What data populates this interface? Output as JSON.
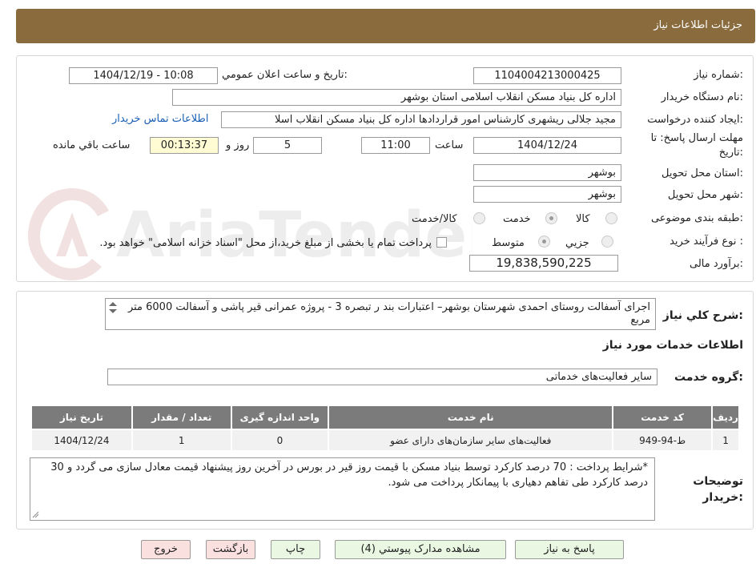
{
  "header": {
    "title": "جزئیات اطلاعات نیاز"
  },
  "fields": {
    "need_number": {
      "label": "شماره نیاز:",
      "value": "1104004213000425"
    },
    "announce_datetime": {
      "label": "تاریخ و ساعت اعلان عمومي:",
      "value": "1404/12/19 - 10:08"
    },
    "buyer_org": {
      "label": "نام دستگاه خريدار:",
      "value": "اداره کل بنیاد مسکن انقلاب اسلامی استان بوشهر"
    },
    "requester": {
      "label": "ايجاد کننده درخواست:",
      "value": "مجید جلالی ریشهری کارشناس امور قراردادها اداره کل بنیاد مسکن انقلاب اسلا",
      "contact_link": "اطلاعات تماس خريدار"
    },
    "deadline": {
      "label_line1": "مهلت ارسال پاسخ: تا",
      "label_line2": "تاريخ:",
      "date": "1404/12/24",
      "time_label": "ساعت",
      "time": "11:00",
      "days": "5",
      "days_label": "روز و",
      "remaining": "00:13:37",
      "remaining_label": "ساعت باقي مانده"
    },
    "delivery_province": {
      "label": "استان محل تحويل:",
      "value": "بوشهر"
    },
    "delivery_city": {
      "label": "شهر محل تحويل:",
      "value": "بوشهر"
    },
    "category": {
      "label": "طبقه بندی موضوعی:",
      "options": [
        "کالا",
        "خدمت",
        "کالا/خدمت"
      ],
      "selected": "خدمت"
    },
    "process": {
      "label": "نوع فرآيند خريد :",
      "options": [
        "جزيي",
        "متوسط"
      ],
      "selected": "متوسط",
      "note": "پرداخت تمام یا بخشی از مبلغ خرید،از محل \"اسناد خزانه اسلامی\" خواهد بود."
    },
    "budget": {
      "label": "برآورد مالی:",
      "value": "19,838,590,225"
    }
  },
  "description": {
    "label": "شرح کلي نياز:",
    "value": "اجرای آسفالت روستای احمدی شهرستان بوشهر– اعتبارات بند ر تبصره 3 - پروژه عمرانی قیر پاشی و آسفالت 6000 متر مربع"
  },
  "services": {
    "section_title": "اطلاعات خدمات مورد نياز",
    "group_label": "گروه خدمت:",
    "group_value": "سایر فعالیت‌های خدماتی",
    "columns": [
      "رديف",
      "کد خدمت",
      "نام خدمت",
      "واحد اندازه گيری",
      "تعداد / مقدار",
      "تاريخ نياز"
    ],
    "rows": [
      [
        "1",
        "ط-94-949",
        "فعالیت‌های سایر سازمان‌های دارای عضو",
        "0",
        "1",
        "1404/12/24"
      ]
    ]
  },
  "buyer_notes": {
    "label_line1": "توضيحات",
    "label_line2": "خريدار:",
    "value": "*شرایط پرداخت : 70 درصد کارکرد توسط بنیاد مسکن با قیمت روز قیر در بورس در آخرین روز پیشنهاد قیمت معادل سازی می گردد و 30 درصد کارکرد طی تفاهم دهیاری با پیمانکار پرداخت می شود."
  },
  "buttons": {
    "reply": "پاسخ به نياز",
    "view_docs": "مشاهده مدارک پيوستي (4)",
    "print": "چاپ",
    "back": "بازگشت",
    "exit": "خروج"
  },
  "watermark": {
    "text": "AriaTender.net"
  }
}
